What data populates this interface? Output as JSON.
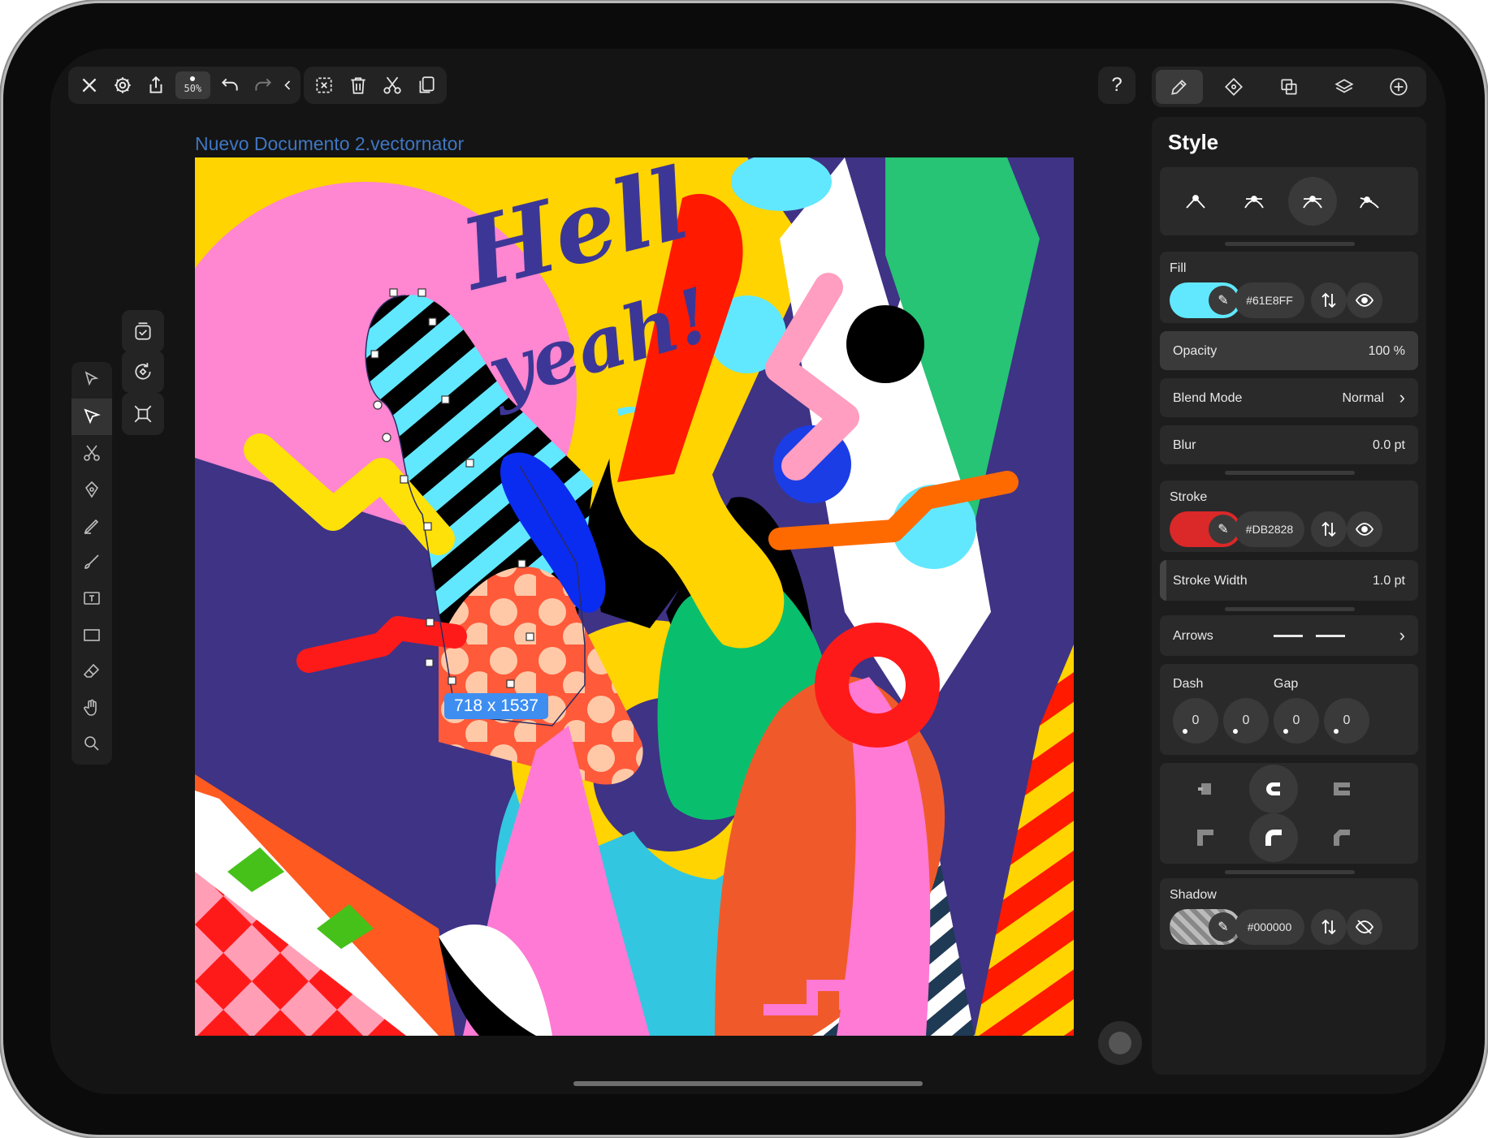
{
  "document": {
    "title": "Nuevo Documento 2.vectornator"
  },
  "toolbar": {
    "zoom_label": "50%",
    "help_label": "?"
  },
  "selection": {
    "dimensions_label": "718 x 1537"
  },
  "canvas": {
    "headline_line1": "Hell",
    "headline_line2": "yeah!"
  },
  "panel": {
    "title": "Style",
    "fill": {
      "label": "Fill",
      "hex": "#61E8FF",
      "color": "#61E8FF"
    },
    "opacity": {
      "label": "Opacity",
      "value": "100 %"
    },
    "blend_mode": {
      "label": "Blend Mode",
      "value": "Normal"
    },
    "blur": {
      "label": "Blur",
      "value": "0.0 pt"
    },
    "stroke": {
      "label": "Stroke",
      "hex": "#DB2828",
      "color": "#DB2828"
    },
    "stroke_width": {
      "label": "Stroke Width",
      "value": "1.0 pt"
    },
    "arrows": {
      "label": "Arrows"
    },
    "dash_gap": {
      "dash_label": "Dash",
      "gap_label": "Gap",
      "values": [
        "0",
        "0",
        "0",
        "0"
      ]
    },
    "shadow": {
      "label": "Shadow",
      "hex": "#000000"
    }
  },
  "icons": {
    "toolbar": [
      "close-icon",
      "settings-icon",
      "share-icon",
      "undo-icon",
      "redo-icon",
      "collapse-chevron-icon",
      "deselect-icon",
      "trash-icon",
      "cut-icon",
      "duplicate-icon"
    ],
    "panel_tabs": [
      "style-brush-icon",
      "path-node-icon",
      "boolean-icon",
      "layers-icon",
      "add-icon"
    ],
    "left_tools": [
      "select-icon",
      "direct-select-icon",
      "scissors-icon",
      "pen-icon",
      "pencil-icon",
      "brush-icon",
      "text-icon",
      "rectangle-icon",
      "eraser-icon",
      "hand-icon",
      "zoom-icon"
    ]
  }
}
